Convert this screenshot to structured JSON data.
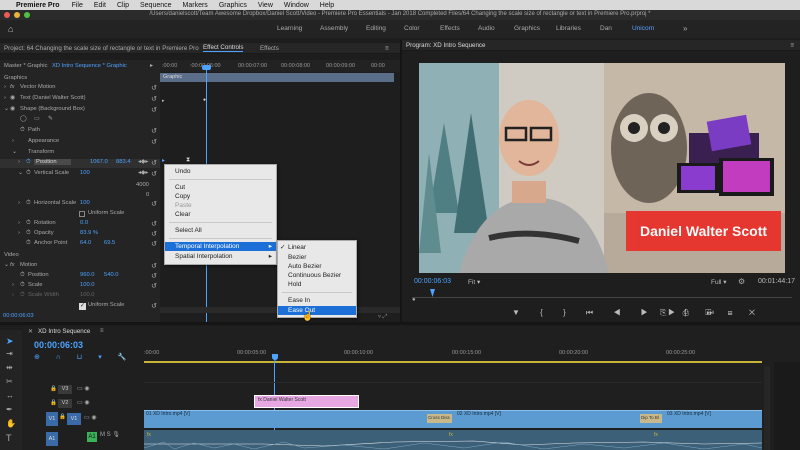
{
  "menubar": {
    "apple": "",
    "app": "Premiere Pro",
    "items": [
      "File",
      "Edit",
      "Clip",
      "Sequence",
      "Markers",
      "Graphics",
      "View",
      "Window",
      "Help"
    ]
  },
  "window": {
    "title": "/Users/danielscott/Team Awesome Dropbox/Daniel Scott/Video - Premiere Pro Essentials - Jan 2018 Completed Files/64 Changing the scale size of rectangle or text in Premiere Pro.prproj *"
  },
  "workspaces": {
    "items": [
      "Learning",
      "Assembly",
      "Editing",
      "Color",
      "Effects",
      "Audio",
      "Graphics",
      "Libraries",
      "Dan",
      "Unicorn"
    ],
    "active": "Unicorn"
  },
  "left_panel": {
    "project_tab": "Project: 64 Changing the scale size of rectangle or text in Premiere Pro",
    "effect_controls_tab": "Effect Controls",
    "effects_tab": "Effects",
    "master": "Master * Graphic",
    "sequence": "XD Intro Sequence * Graphic",
    "timecodes": [
      ":00:00",
      ":00:00:06:00",
      "00:00:07:00",
      "00:00:08:00",
      "00:00:09:00",
      "00:00"
    ],
    "clip_bar": "Graphic",
    "graphics_header": "Graphics",
    "vector_motion": "Vector Motion",
    "text_layer": "Text (Daniel Walter Scott)",
    "shape_layer": "Shape (Background Box)",
    "path": "Path",
    "appearance": "Appearance",
    "transform": "Transform",
    "position": {
      "label": "Position",
      "x": "1067.0",
      "y": "883.4"
    },
    "vertical_scale": {
      "label": "Vertical Scale",
      "value": "100"
    },
    "graph_max": "4000",
    "graph_min": "0",
    "horizontal_scale": {
      "label": "Horizontal Scale",
      "value": "100"
    },
    "uniform_scale": "Uniform Scale",
    "rotation": {
      "label": "Rotation",
      "value": "0.0"
    },
    "opacity": {
      "label": "Opacity",
      "value": "83.9 %"
    },
    "anchor_point": {
      "label": "Anchor Point",
      "x": "64.0",
      "y": "69.5"
    },
    "video_header": "Video",
    "motion": "Motion",
    "v_position": {
      "label": "Position",
      "x": "960.0",
      "y": "540.0"
    },
    "scale": {
      "label": "Scale",
      "value": "100.0"
    },
    "scale_width": {
      "label": "Scale Width",
      "value": "100.0"
    },
    "uniform_scale2": "Uniform Scale",
    "current_time": "00:00:06:03"
  },
  "context_menu": {
    "items": [
      "Undo",
      "Cut",
      "Copy",
      "Paste",
      "Clear",
      "Select All",
      "Temporal Interpolation",
      "Spatial Interpolation"
    ],
    "submenu": [
      "Linear",
      "Bezier",
      "Auto Bezier",
      "Continuous Bezier",
      "Hold",
      "Ease In",
      "Ease Out"
    ],
    "checked": "Linear",
    "highlighted": "Ease Out"
  },
  "program_monitor": {
    "title": "Program: XD Intro Sequence",
    "lower_third": "Daniel Walter Scott",
    "timecode": "00:00:06:03",
    "fit": "Fit",
    "quality": "Full",
    "duration": "00:01:44:17"
  },
  "timeline": {
    "sequence_tab": "XD Intro Sequence",
    "timecode": "00:00:06:03",
    "ruler": [
      ":00:00",
      "00:00:05:00",
      "00:00:10:00",
      "00:00:15:00",
      "00:00:20:00",
      "00:00:25:00"
    ],
    "tracks": [
      "V3",
      "V2",
      "V1",
      "A1"
    ],
    "graphic_clip": "Daniel Walter Scott",
    "clip1": "01 XD Intro.mp4 [V]",
    "clip2": "02 XD Intro.mp4 [V]",
    "clip3": "03 XD Intro.mp4 [V]",
    "cross_dissolve": "Cross Diss",
    "dip_to_black": "Dip To Bl"
  },
  "colors": {
    "accent": "#4da3ff",
    "selection": "#1c6fd6",
    "graphic_clip": "#e7a7e2",
    "video_clip": "#5b9bd1",
    "timecode": "#4da3ff"
  }
}
